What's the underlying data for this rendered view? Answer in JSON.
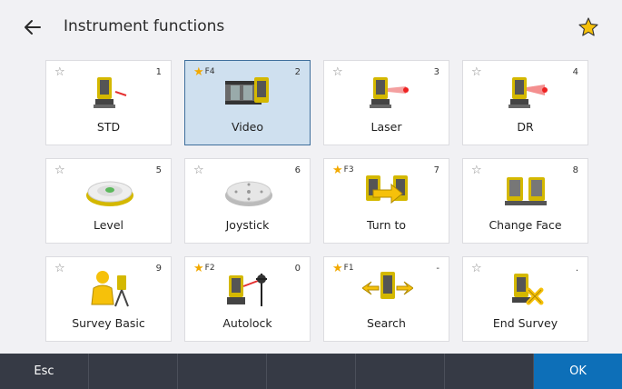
{
  "header": {
    "title": "Instrument functions",
    "back_icon": "arrow-left-icon",
    "favorite_icon": "star-icon"
  },
  "colors": {
    "accent_blue": "#0d6fb8",
    "selected_tile": "#cfe0ef",
    "star_gold": "#f2a900",
    "footer_bg": "#363a45"
  },
  "tiles": [
    {
      "label": "STD",
      "number": "1",
      "fkey": "",
      "starred": false,
      "icon": "total-station-std-icon"
    },
    {
      "label": "Video",
      "number": "2",
      "fkey": "F4",
      "starred": true,
      "icon": "video-film-icon",
      "selected": true
    },
    {
      "label": "Laser",
      "number": "3",
      "fkey": "",
      "starred": false,
      "icon": "laser-pointer-icon"
    },
    {
      "label": "DR",
      "number": "4",
      "fkey": "",
      "starred": false,
      "icon": "dr-laser-icon"
    },
    {
      "label": "Level",
      "number": "5",
      "fkey": "",
      "starred": false,
      "icon": "bubble-level-icon"
    },
    {
      "label": "Joystick",
      "number": "6",
      "fkey": "",
      "starred": false,
      "icon": "joystick-pad-icon"
    },
    {
      "label": "Turn to",
      "number": "7",
      "fkey": "F3",
      "starred": true,
      "icon": "turn-to-icon"
    },
    {
      "label": "Change Face",
      "number": "8",
      "fkey": "",
      "starred": false,
      "icon": "change-face-icon"
    },
    {
      "label": "Survey Basic",
      "number": "9",
      "fkey": "",
      "starred": false,
      "icon": "survey-basic-icon"
    },
    {
      "label": "Autolock",
      "number": "0",
      "fkey": "F2",
      "starred": true,
      "icon": "autolock-prism-icon"
    },
    {
      "label": "Search",
      "number": "-",
      "fkey": "F1",
      "starred": true,
      "icon": "search-instrument-icon"
    },
    {
      "label": "End Survey",
      "number": ".",
      "fkey": "",
      "starred": false,
      "icon": "end-survey-icon"
    }
  ],
  "footer": {
    "esc_label": "Esc",
    "ok_label": "OK"
  }
}
